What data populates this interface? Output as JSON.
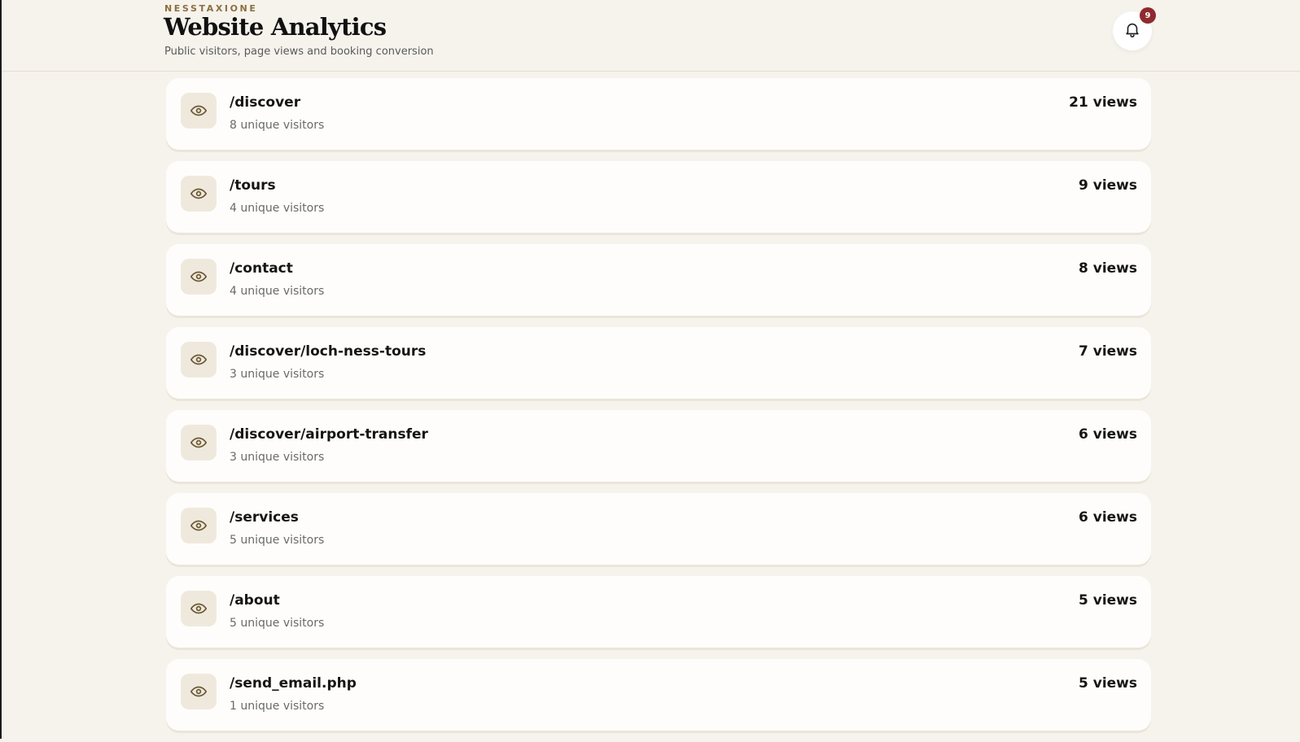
{
  "header": {
    "brand": "NESSTAXIONE",
    "title": "Website Analytics",
    "subtitle": "Public visitors, page views and booking conversion",
    "notifications": {
      "icon": "bell-icon",
      "count": "9"
    }
  },
  "pages": [
    {
      "path": "/discover",
      "visitors": "8 unique visitors",
      "views": "21 views"
    },
    {
      "path": "/tours",
      "visitors": "4 unique visitors",
      "views": "9 views"
    },
    {
      "path": "/contact",
      "visitors": "4 unique visitors",
      "views": "8 views"
    },
    {
      "path": "/discover/loch-ness-tours",
      "visitors": "3 unique visitors",
      "views": "7 views"
    },
    {
      "path": "/discover/airport-transfer",
      "visitors": "3 unique visitors",
      "views": "6 views"
    },
    {
      "path": "/services",
      "visitors": "5 unique visitors",
      "views": "6 views"
    },
    {
      "path": "/about",
      "visitors": "5 unique visitors",
      "views": "5 views"
    },
    {
      "path": "/send_email.php",
      "visitors": "1 unique visitors",
      "views": "5 views"
    }
  ],
  "row_icon": "eye-icon",
  "colors": {
    "accent_gold": "#8b6f3e",
    "badge_red": "#8f2a2f",
    "background": "#f6f3ed",
    "card": "#fefdfb"
  }
}
